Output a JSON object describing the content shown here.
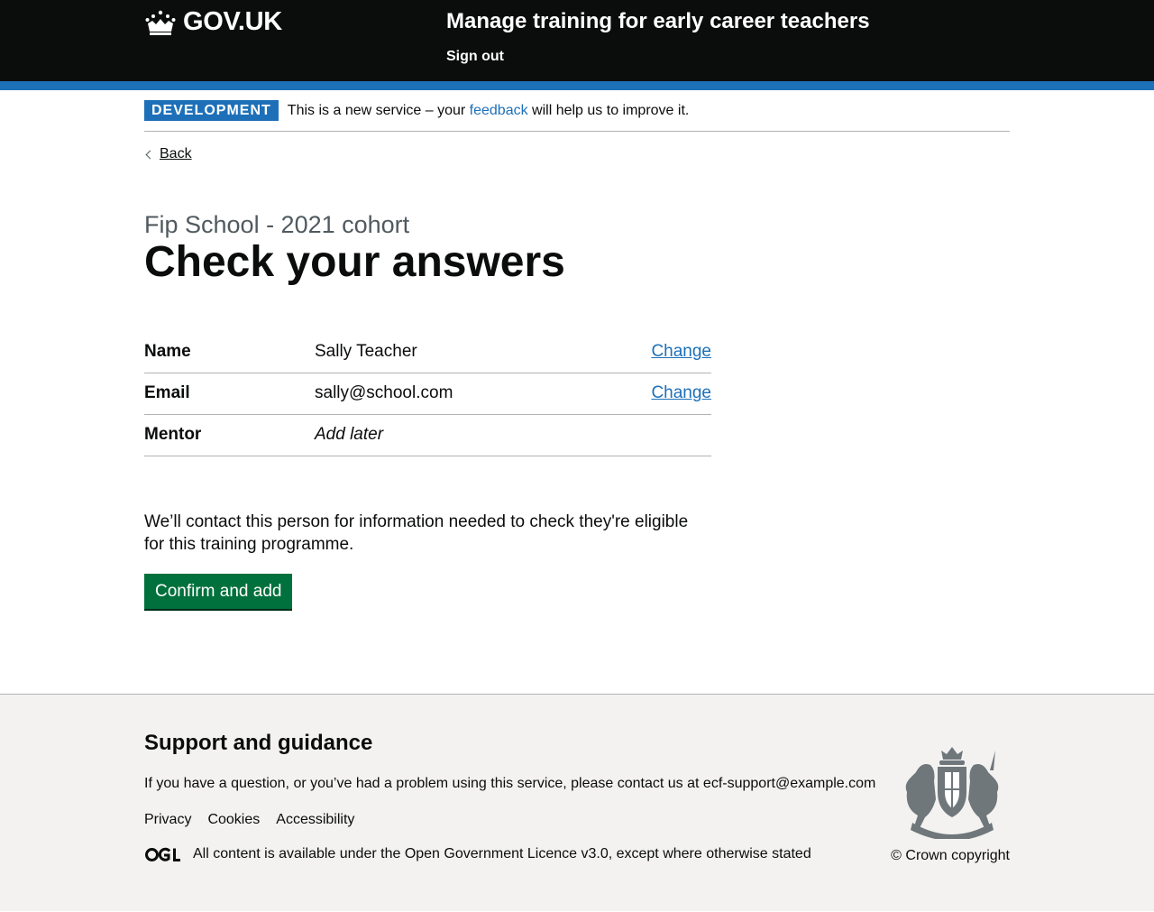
{
  "header": {
    "logo_text": "GOV.UK",
    "service_name": "Manage training for early career teachers",
    "sign_out": "Sign out"
  },
  "phase_banner": {
    "tag": "DEVELOPMENT",
    "text_before": "This is a new service – your ",
    "link": "feedback",
    "text_after": " will help us to improve it."
  },
  "back_link": "Back",
  "caption": "Fip School - 2021 cohort",
  "title": "Check your answers",
  "summary": [
    {
      "key": "Name",
      "value": "Sally Teacher",
      "action": "Change"
    },
    {
      "key": "Email",
      "value": "sally@school.com",
      "action": "Change"
    },
    {
      "key": "Mentor",
      "value": "Add later",
      "action": ""
    }
  ],
  "info_text": "We’ll contact this person for information needed to check they're eligible for this training programme.",
  "confirm_button": "Confirm and add",
  "footer": {
    "title": "Support and guidance",
    "contact_text": "If you have a question, or you’ve had a problem using this service, please contact us at ",
    "contact_email": "ecf-support@example.com",
    "links": [
      "Privacy",
      "Cookies",
      "Accessibility"
    ],
    "licence_before": "All content is available under the ",
    "licence_link": "Open Government Licence v3.0",
    "licence_after": ", except where otherwise stated",
    "copyright": "© Crown copyright"
  },
  "colors": {
    "header_bg": "#0b0c0c",
    "brand_blue": "#1d70b8",
    "button_green": "#00703c",
    "footer_bg": "#f3f2f1",
    "secondary_text": "#505a5f"
  },
  "icons": {
    "logo": "crown-icon",
    "back": "chevron-left-icon",
    "licence": "ogl-icon",
    "crest": "royal-coat-of-arms-icon"
  }
}
